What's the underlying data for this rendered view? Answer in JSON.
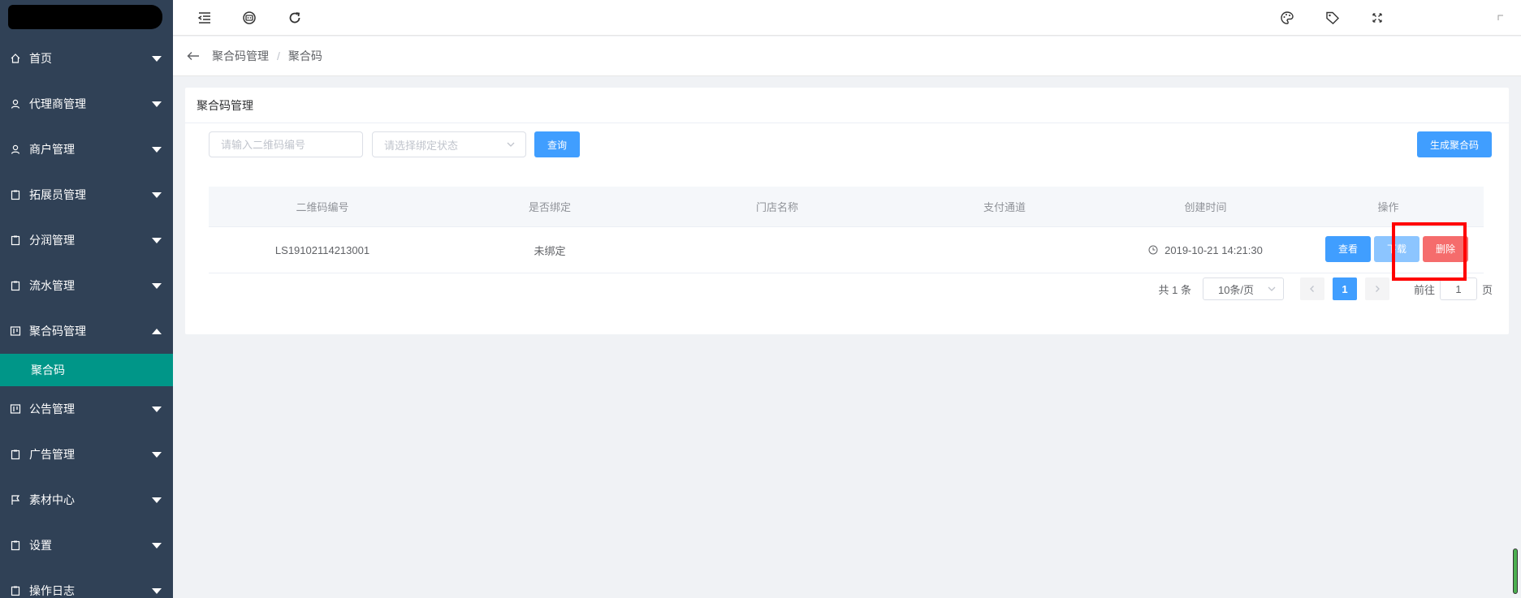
{
  "colors": {
    "sidebar_bg": "#304156",
    "sidebar_active": "#009688",
    "primary": "#409eff",
    "primary_light": "#8cc5ff",
    "danger": "#f56c6c",
    "highlight": "#ff0000"
  },
  "sidebar": {
    "items": [
      {
        "label": "首页",
        "icon": "home-icon"
      },
      {
        "label": "代理商管理",
        "icon": "user-icon"
      },
      {
        "label": "商户管理",
        "icon": "user-icon"
      },
      {
        "label": "拓展员管理",
        "icon": "clipboard-icon"
      },
      {
        "label": "分润管理",
        "icon": "clipboard-icon"
      },
      {
        "label": "流水管理",
        "icon": "clipboard-icon"
      },
      {
        "label": "聚合码管理",
        "icon": "qrcode-doc-icon",
        "expanded": true
      },
      {
        "label": "公告管理",
        "icon": "qrcode-doc-icon"
      },
      {
        "label": "广告管理",
        "icon": "clipboard-icon"
      },
      {
        "label": "素材中心",
        "icon": "flag-icon"
      },
      {
        "label": "设置",
        "icon": "clipboard-icon"
      },
      {
        "label": "操作日志",
        "icon": "clipboard-icon"
      }
    ],
    "submenu": {
      "label": "聚合码"
    }
  },
  "navbar": {
    "icons": [
      "collapse-menu-icon",
      "face-icon",
      "refresh-icon",
      "palette-icon",
      "tag-icon",
      "fullscreen-icon"
    ]
  },
  "breadcrumb": {
    "parent": "聚合码管理",
    "separator": "/",
    "current": "聚合码"
  },
  "card": {
    "title": "聚合码管理"
  },
  "toolbar": {
    "qrcode_input_placeholder": "请输入二维码编号",
    "bind_status_placeholder": "请选择绑定状态",
    "search_label": "查询",
    "generate_label": "生成聚合码"
  },
  "table": {
    "headers": [
      "二维码编号",
      "是否绑定",
      "门店名称",
      "支付通道",
      "创建时间",
      "操作"
    ],
    "rows": [
      {
        "code": "LS19102114213001",
        "bound": "未绑定",
        "store": "",
        "channel": "",
        "created": "2019-10-21 14:21:30",
        "actions": {
          "view": "查看",
          "download": "下载",
          "delete": "删除"
        }
      }
    ]
  },
  "pagination": {
    "total": "共 1 条",
    "page_size": "10条/页",
    "current_page": "1",
    "goto_label": "前往",
    "goto_value": "1",
    "page_suffix": "页"
  }
}
